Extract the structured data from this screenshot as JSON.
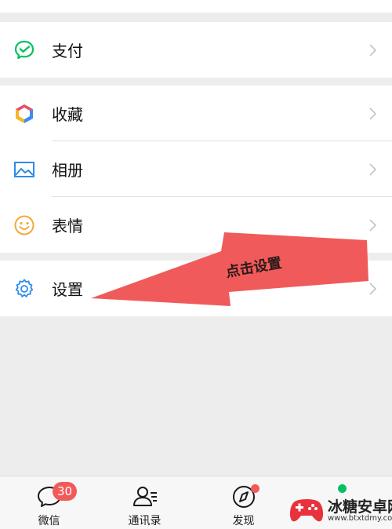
{
  "menu": {
    "pay": {
      "label": "支付",
      "icon": "wechat-pay-icon"
    },
    "favorites": {
      "label": "收藏",
      "icon": "favorites-cube-icon"
    },
    "album": {
      "label": "相册",
      "icon": "album-picture-icon"
    },
    "stickers": {
      "label": "表情",
      "icon": "smiley-icon"
    },
    "settings": {
      "label": "设置",
      "icon": "gear-icon"
    }
  },
  "annotation": {
    "text": "点击设置",
    "color": "#f15a5a"
  },
  "tabbar": {
    "chats": {
      "label": "微信",
      "badge": "30"
    },
    "contacts": {
      "label": "通讯录"
    },
    "discover": {
      "label": "发现"
    }
  },
  "watermark": {
    "title": "冰糖安卓网",
    "url": "www.btxtdmy.com"
  },
  "colors": {
    "background": "#ededed",
    "badge": "#f15a5a",
    "wechat_green": "#07c160"
  }
}
